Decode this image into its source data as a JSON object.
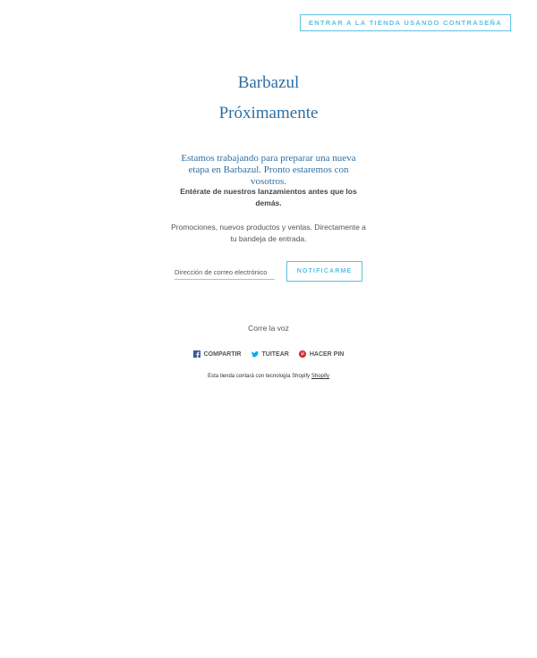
{
  "header": {
    "password_button_label": "ENTRAR A LA TIENDA USANDO CONTRASEÑA"
  },
  "main": {
    "store_name": "Barbazul",
    "coming_soon": "Próximamente",
    "intro": "Estamos trabajando para preparar una nueva etapa en Barbazul. Pronto estaremos con vosotros."
  },
  "signup": {
    "heading": "Entérate de nuestros lanzamientos antes que los demás.",
    "text": "Promociones, nuevos productos y ventas. Directamente a tu bandeja de entrada.",
    "email_placeholder": "Dirección de correo electrónico",
    "email_value": "",
    "submit_label": "NOTIFICARME"
  },
  "share": {
    "title": "Corre la voz",
    "items": [
      {
        "label": "COMPARTIR",
        "icon": "facebook-icon",
        "color": "#3b5998"
      },
      {
        "label": "TUITEAR",
        "icon": "twitter-icon",
        "color": "#00aced"
      },
      {
        "label": "HACER PIN",
        "icon": "pinterest-icon",
        "color": "#cb2127"
      }
    ]
  },
  "footer": {
    "text": "Esta tienda contará con tecnología Shopify",
    "link_label": "Shopify"
  },
  "colors": {
    "accent": "#5cc2e4",
    "heading": "#2f6fa3",
    "body_text": "#555555"
  }
}
